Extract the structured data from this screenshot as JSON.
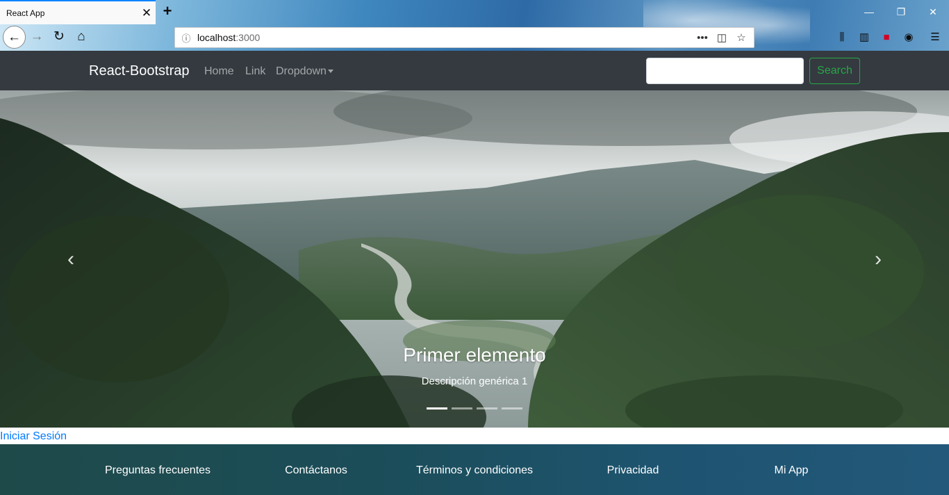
{
  "browser": {
    "tab_title": "React App",
    "url_host": "localhost",
    "url_port": ":3000",
    "icons": [
      "close-icon",
      "plus-icon",
      "back-arrow-icon",
      "forward-arrow-icon",
      "reload-icon",
      "home-icon",
      "info-icon",
      "more-icon",
      "pocket-icon",
      "star-icon",
      "library-icon",
      "sidebar-icon",
      "extension-icon",
      "account-icon",
      "menu-icon"
    ]
  },
  "navbar": {
    "brand": "React-Bootstrap",
    "links": [
      "Home",
      "Link",
      "Dropdown"
    ],
    "search_placeholder": "",
    "search_button": "Search"
  },
  "carousel": {
    "title": "Primer elemento",
    "description": "Descripción genérica 1",
    "slide_count": 4,
    "active_slide": 1
  },
  "login_link": "Iniciar Sesión",
  "footer": {
    "links": [
      "Preguntas frecuentes",
      "Contáctanos",
      "Términos y condiciones",
      "Privacidad",
      "Mi App"
    ]
  },
  "colors": {
    "navbar_bg": "#343a40",
    "success": "#28a745",
    "link": "#007bff"
  }
}
